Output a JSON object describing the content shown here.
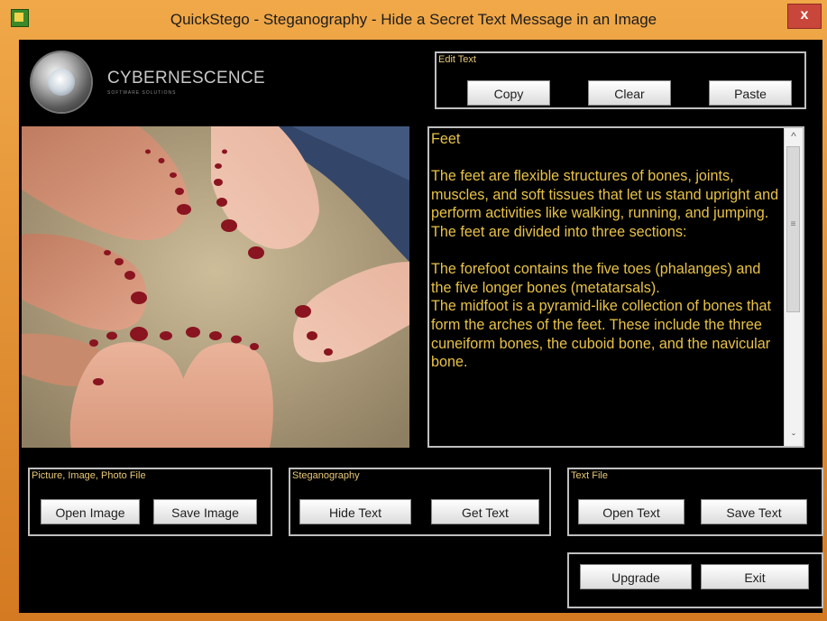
{
  "window": {
    "title": "QuickStego - Steganography - Hide a Secret Text Message in an Image",
    "close_label": "x"
  },
  "brand": {
    "name": "CYBERNESCENCE",
    "tagline": "SOFTWARE SOLUTIONS"
  },
  "edit_text": {
    "label": "Edit Text",
    "copy": "Copy",
    "clear": "Clear",
    "paste": "Paste"
  },
  "message": {
    "title": "Feet",
    "paragraph1": "The feet are flexible structures of bones, joints, muscles, and soft tissues that let us stand upright and perform activities like walking, running, and jumping. The feet are divided into three sections:",
    "paragraph2": "The forefoot contains the five toes (phalanges) and the five longer bones (metatarsals).",
    "paragraph3": "The midfoot is a pyramid-like collection of bones that form the arches of the feet. These include the three cuneiform bones, the cuboid bone, and the navicular bone."
  },
  "picture_file": {
    "label": "Picture, Image, Photo File",
    "open": "Open Image",
    "save": "Save Image"
  },
  "steganography": {
    "label": "Steganography",
    "hide": "Hide Text",
    "get": "Get Text"
  },
  "text_file": {
    "label": "Text File",
    "open": "Open Text",
    "save": "Save Text"
  },
  "bottom": {
    "upgrade": "Upgrade",
    "exit": "Exit"
  },
  "colors": {
    "titlebar": "#e08a30",
    "background": "#000000",
    "message_text": "#e8c247",
    "group_label": "#e8c878",
    "close_button": "#c9463a"
  },
  "icons": {
    "app": "quickstego-app-icon",
    "logo": "cybernescence-logo",
    "scroll_up": "scroll-up-arrow",
    "scroll_down": "scroll-down-arrow"
  }
}
